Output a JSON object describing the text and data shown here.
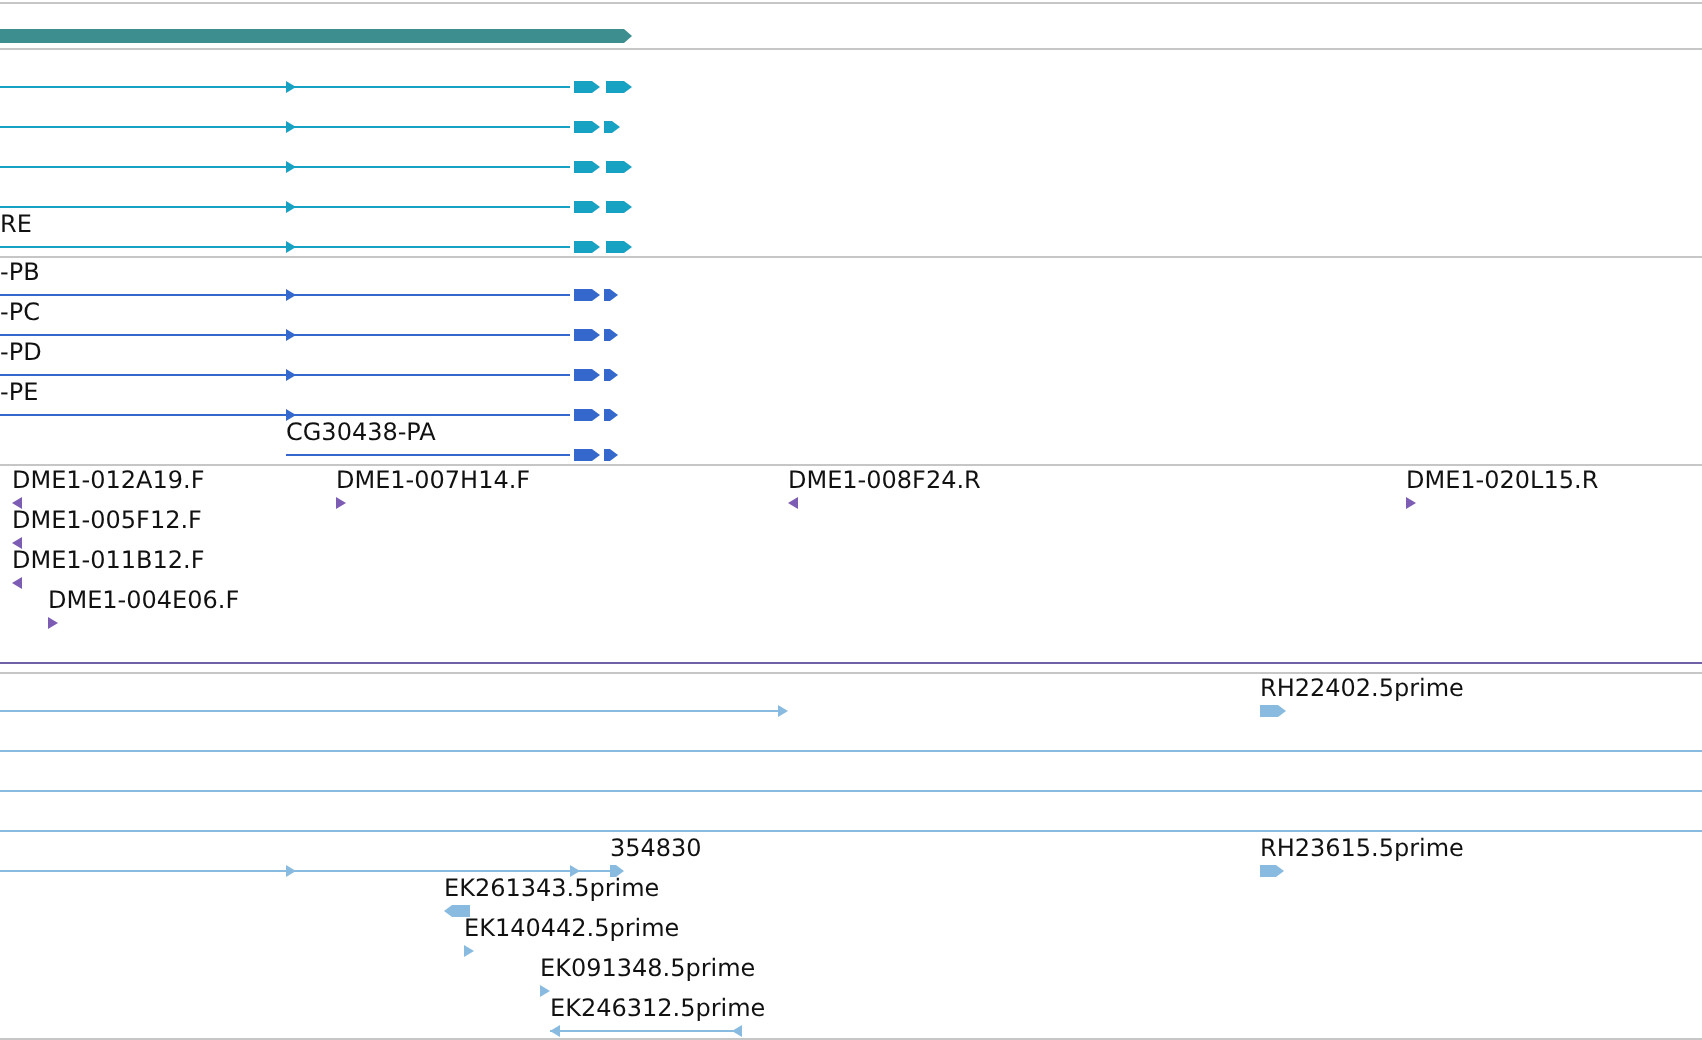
{
  "tracks": [
    {
      "color": "#3d8f8f",
      "features": [
        {
          "kind": "bar",
          "reverse": false
        }
      ]
    },
    {
      "color": "#17a2c4",
      "features": [
        {
          "kind": "transcript",
          "reverse": false
        },
        {
          "kind": "transcript",
          "reverse": false
        },
        {
          "kind": "transcript",
          "reverse": false
        },
        {
          "kind": "transcript",
          "reverse": false
        },
        {
          "kind": "transcript",
          "reverse": false,
          "label": "RE"
        }
      ]
    },
    {
      "color": "#3468cc",
      "features": [
        {
          "kind": "transcript",
          "reverse": false,
          "label": "-PB"
        },
        {
          "kind": "transcript",
          "reverse": false,
          "label": "-PC"
        },
        {
          "kind": "transcript",
          "reverse": false,
          "label": "-PD"
        },
        {
          "kind": "transcript",
          "reverse": false,
          "label": "-PE"
        },
        {
          "kind": "transcript",
          "reverse": false,
          "label": "CG30438-PA"
        }
      ]
    },
    {
      "color": "#7d5cb4",
      "features": [
        {
          "kind": "marker",
          "reverse": true,
          "label": "DME1-012A19.F"
        },
        {
          "kind": "marker",
          "reverse": false,
          "label": "DME1-007H14.F"
        },
        {
          "kind": "marker",
          "reverse": true,
          "label": "DME1-008F24.R"
        },
        {
          "kind": "marker",
          "reverse": false,
          "label": "DME1-020L15.R"
        },
        {
          "kind": "marker",
          "reverse": true,
          "label": "DME1-005F12.F"
        },
        {
          "kind": "marker",
          "reverse": true,
          "label": "DME1-011B12.F"
        },
        {
          "kind": "marker",
          "reverse": false,
          "label": "DME1-004E06.F"
        }
      ]
    },
    {
      "color": "#88bbdf",
      "features": [
        {
          "kind": "transcript",
          "reverse": false
        },
        {
          "kind": "marker",
          "reverse": false,
          "label": "RH22402.5prime"
        },
        {
          "kind": "transcript"
        },
        {
          "kind": "transcript"
        },
        {
          "kind": "transcript"
        },
        {
          "kind": "transcript",
          "reverse": false
        },
        {
          "kind": "marker",
          "reverse": false,
          "label": "354830"
        },
        {
          "kind": "marker",
          "reverse": false,
          "label": "RH23615.5prime"
        },
        {
          "kind": "marker",
          "reverse": true,
          "label": "EK261343.5prime"
        },
        {
          "kind": "marker",
          "reverse": false,
          "label": "EK140442.5prime"
        },
        {
          "kind": "marker",
          "reverse": false,
          "label": "EK091348.5prime"
        },
        {
          "kind": "transcript",
          "reverse": true,
          "label": "EK246312.5prime"
        }
      ]
    }
  ]
}
